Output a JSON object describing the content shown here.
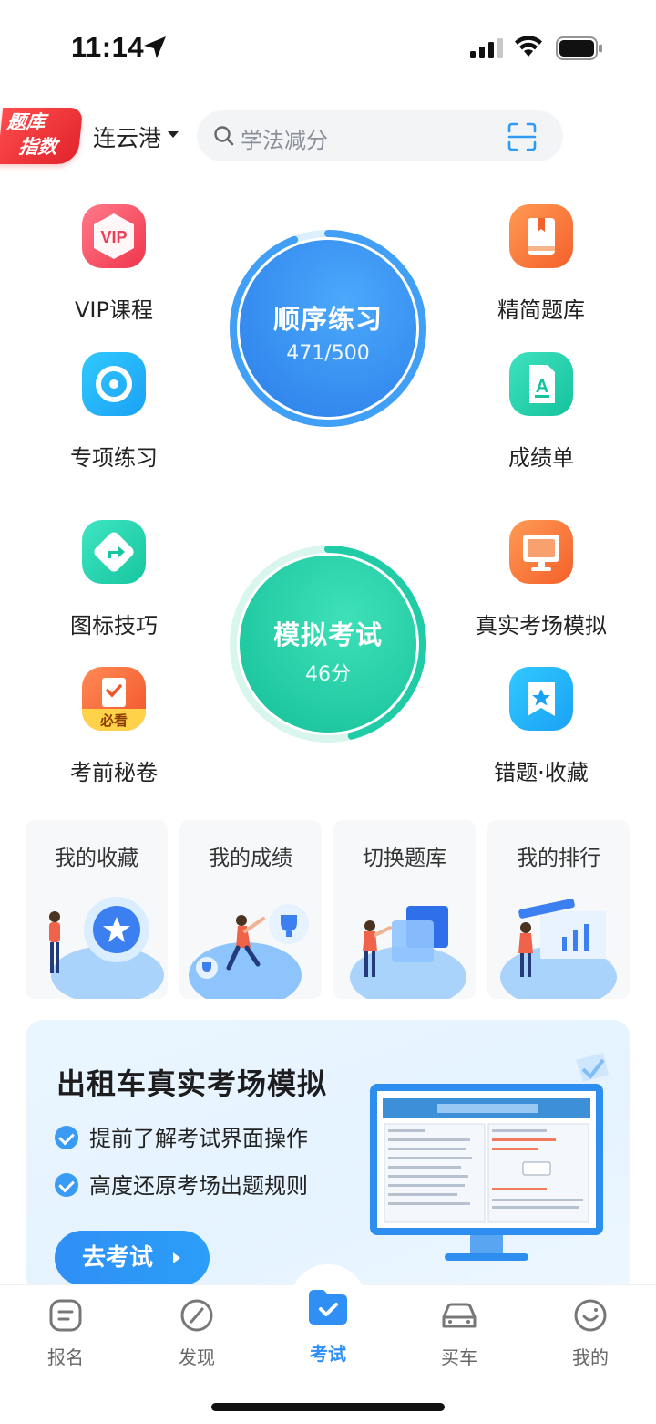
{
  "status": {
    "time": "11:14"
  },
  "header": {
    "badge_line1": "题库",
    "badge_line2": "指数",
    "city": "连云港",
    "search_placeholder": "学法减分"
  },
  "grid": {
    "vip_label": "VIP课程",
    "vip_icon_text": "VIP",
    "jingjian_label": "精简题库",
    "zhuanxiang_label": "专项练习",
    "chengji_label": "成绩单",
    "tubiao_label": "图标技巧",
    "zhenshi_label": "真实考场模拟",
    "kaoqian_label": "考前秘卷",
    "kaoqian_badge": "必看",
    "cuoti_label": "错题·收藏"
  },
  "practice": {
    "title": "顺序练习",
    "progress": "471/500",
    "done": 471,
    "total": 500
  },
  "exam": {
    "title": "模拟考试",
    "score": "46分",
    "score_value": 46,
    "max": 100
  },
  "cards": [
    {
      "title": "我的收藏"
    },
    {
      "title": "我的成绩"
    },
    {
      "title": "切换题库"
    },
    {
      "title": "我的排行"
    }
  ],
  "banner": {
    "title": "出租车真实考场模拟",
    "features": [
      "提前了解考试界面操作",
      "高度还原考场出题规则"
    ],
    "button": "去考试"
  },
  "tabs": [
    {
      "label": "报名",
      "icon": "signup-icon"
    },
    {
      "label": "发现",
      "icon": "compass-icon"
    },
    {
      "label": "考试",
      "icon": "exam-folder-icon",
      "active": true
    },
    {
      "label": "买车",
      "icon": "car-icon"
    },
    {
      "label": "我的",
      "icon": "profile-icon"
    }
  ],
  "colors": {
    "accent": "#2f8ff5",
    "practice": "#3b8ff5",
    "exam": "#1fcca6",
    "badge": "#e3262e"
  }
}
